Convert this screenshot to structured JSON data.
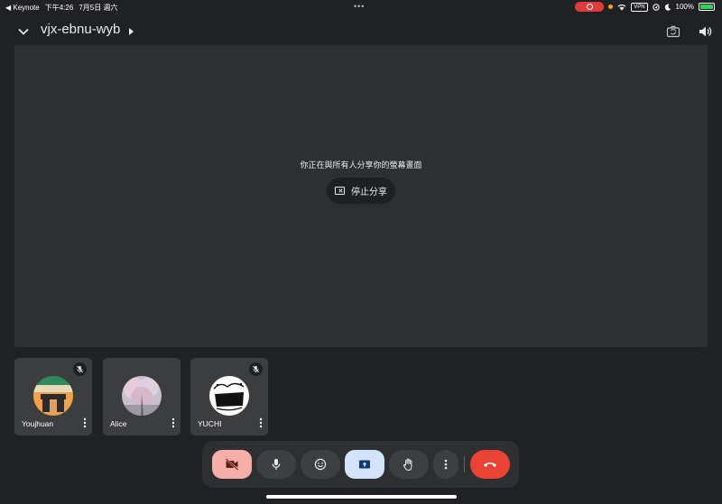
{
  "status_bar": {
    "back_app": "Keynote",
    "time": "下午4:26",
    "date": "7月5日 週六",
    "vpn": "VPN",
    "battery": "100%",
    "battery_level": 1.0
  },
  "header": {
    "meeting_code": "vjx-ebnu-wyb",
    "icons": [
      "chevron-down-icon",
      "camera-flip-icon",
      "speaker-icon"
    ]
  },
  "stage": {
    "share_message": "你正在與所有人分享你的螢幕畫面",
    "stop_label": "停止分享"
  },
  "participants": [
    {
      "name": "Youjhuan",
      "muted": true
    },
    {
      "name": "Alice",
      "muted": false
    },
    {
      "name": "YUCHI",
      "muted": true,
      "avatar_text": "Cafe Club"
    }
  ],
  "controls": {
    "items": [
      "camera-off",
      "microphone",
      "reactions",
      "present-screen",
      "raise-hand",
      "more-options",
      "end-call"
    ],
    "colors": {
      "camera_off_bg": "#f6aea9",
      "present_bg": "#d3e3fd",
      "end_call_bg": "#ea4335"
    }
  }
}
